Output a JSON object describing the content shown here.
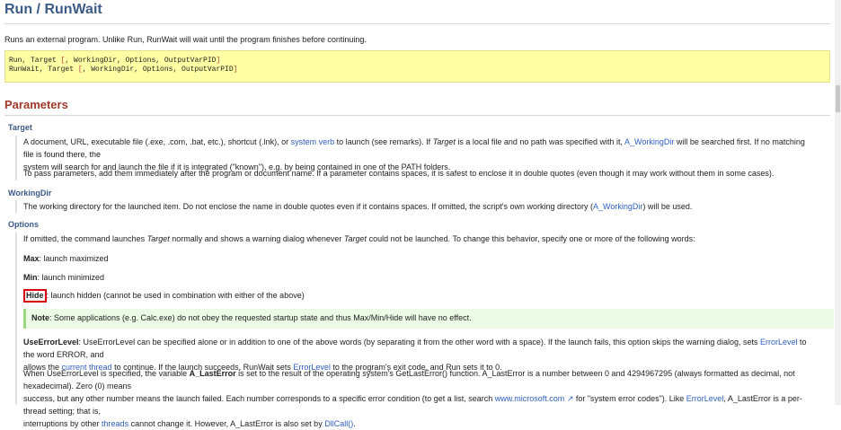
{
  "title": "Run / RunWait",
  "description": "Runs an external program. Unlike Run, RunWait will wait until the program finishes before continuing.",
  "syntax": {
    "line1_cmd": "Run, Target ",
    "line1_open": "[",
    "line1_rest": ", WorkingDir, Options, OutputVarPID",
    "line1_close": "]",
    "line2_cmd": "RunWait, Target ",
    "line2_open": "[",
    "line2_rest": ", WorkingDir, Options, OutputVarPID",
    "line2_close": "]"
  },
  "parameters_heading": "Parameters",
  "target": {
    "label": "Target",
    "p1_a": "A document, URL, executable file (.exe, .com, .bat, etc.), shortcut (.lnk), or ",
    "p1_link1": "system verb",
    "p1_b": " to launch (see remarks). If ",
    "p1_i": "Target",
    "p1_c": " is a local file and no path was specified with it, ",
    "p1_link2": "A_WorkingDir",
    "p1_d": " will be searched first. If no matching file is found there, the",
    "p1_line2": "system will search for and launch the file if it is integrated (\"known\"), e.g. by being contained in one of the PATH folders.",
    "p2": "To pass parameters, add them immediately after the program or document name. If a parameter contains spaces, it is safest to enclose it in double quotes (even though it may work without them in some cases)."
  },
  "workingdir": {
    "label": "WorkingDir",
    "p_a": "The working directory for the launched item. Do not enclose the name in double quotes even if it contains spaces. If omitted, the script's own working directory (",
    "p_link": "A_WorkingDir",
    "p_b": ") will be used."
  },
  "options": {
    "label": "Options",
    "intro_a": "If omitted, the command launches ",
    "intro_i1": "Target",
    "intro_b": " normally and shows a warning dialog whenever ",
    "intro_i2": "Target",
    "intro_c": " could not be launched. To change this behavior, specify one or more of the following words:",
    "max_b": "Max",
    "max_t": ": launch maximized",
    "min_b": "Min",
    "min_t": ": launch minimized",
    "hide_b": "Hide",
    "hide_t": ": launch hidden (cannot be used in combination with either of the above)",
    "note_b": "Note",
    "note_t": ": Some applications (e.g. Calc.exe) do not obey the requested startup state and thus Max/Min/Hide will have no effect.",
    "uel_b": "UseErrorLevel",
    "uel_a": ": UseErrorLevel can be specified alone or in addition to one of the above words (by separating it from the other word with a space). If the launch fails, this option skips the warning dialog, sets ",
    "uel_link1": "ErrorLevel",
    "uel_c": " to the word ERROR, and",
    "uel2_a": "allows the ",
    "uel2_link": "current thread",
    "uel2_b": " to continue. If the launch succeeds, RunWait sets ",
    "uel2_link2": "ErrorLevel",
    "uel2_c": " to the program's exit code, and Run sets it to 0.",
    "le1_a": "When UseErrorLevel is specified, the variable ",
    "le1_b": "A_LastError",
    "le1_c": " is set to the result of the operating system's GetLastError() function. A_LastError is a number between 0 and 4294967295 (always formatted as decimal, not hexadecimal). Zero (0) means",
    "le2_a": "success, but any other number means the launch failed. Each number corresponds to a specific error condition (to get a list, search ",
    "le2_link": "www.microsoft.com",
    "le2_icon": "↗",
    "le2_b": " for \"system error codes\"). Like ",
    "le2_link2": "ErrorLevel",
    "le2_c": ", A_LastError is a per-thread setting; that is,",
    "le3_a": "interruptions by other ",
    "le3_link": "threads",
    "le3_b": " cannot change it. However, A_LastError is also set by ",
    "le3_link2": "DllCall()",
    "le3_c": "."
  }
}
